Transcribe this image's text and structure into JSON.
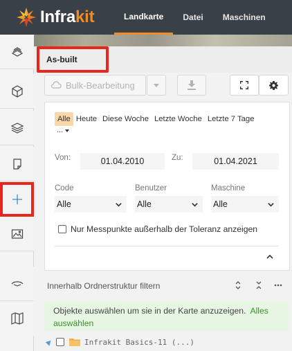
{
  "topbar": {
    "brand_prefix": "Infra",
    "brand_suffix": "kit",
    "tabs": [
      {
        "label": "Landkarte",
        "active": true
      },
      {
        "label": "Datei",
        "active": false
      },
      {
        "label": "Maschinen",
        "active": false
      }
    ],
    "accent": "#f28b21"
  },
  "rail": {
    "items": [
      {
        "icon": "layers-stack-icon"
      },
      {
        "icon": "cube-icon"
      },
      {
        "icon": "layers-icon"
      },
      {
        "icon": "note-icon"
      },
      {
        "icon": "crosshair-icon",
        "selected": true
      },
      {
        "icon": "image-icon"
      },
      {
        "icon": "route-icon"
      },
      {
        "icon": "map-icon"
      }
    ]
  },
  "panel": {
    "title": "As-built",
    "toolbar": {
      "bulk_label": "Bulk-Bearbeitung"
    },
    "filter": {
      "chips": [
        "Alle",
        "Heute",
        "Diese Woche",
        "Letzte Woche",
        "Letzte 7 Tage"
      ],
      "active_chip": "Alle",
      "more_label": "...",
      "from_label": "Von:",
      "from_value": "01.04.2010",
      "to_label": "Zu:",
      "to_value": "01.04.2021",
      "code_label": "Code",
      "code_value": "Alle",
      "user_label": "Benutzer",
      "user_value": "Alle",
      "machine_label": "Maschine",
      "machine_value": "Alle",
      "tolerance_label": "Nur Messpunkte außerhalb der Toleranz anzeigen",
      "tolerance_checked": false
    },
    "folder_filter_label": "Innerhalb Ordnerstruktur filtern",
    "info_text": "Objekte auswählen um sie in der Karte anzuzeigen.",
    "select_all_label": "Alles auswählen",
    "tree": [
      {
        "label": "Infrakit Basics-11 (...)",
        "checked": false
      }
    ]
  },
  "colors": {
    "highlight": "#e8261c",
    "info_bg": "#e7f6e2",
    "link_green": "#3a8f2a",
    "chip_active": "#fad6a8"
  }
}
